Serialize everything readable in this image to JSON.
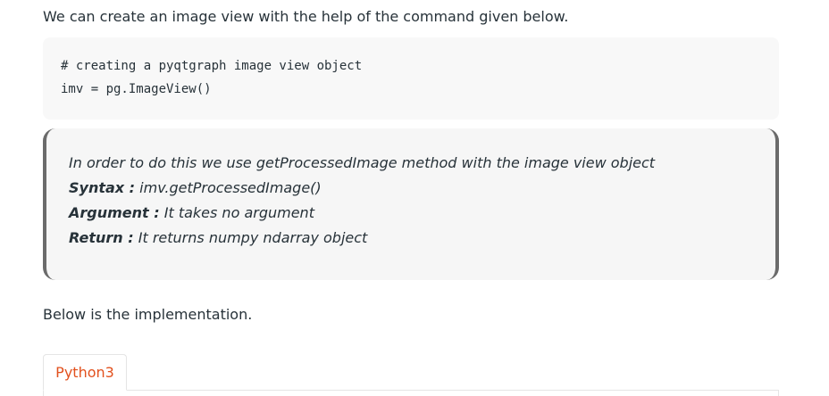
{
  "article": {
    "intro_text": "We can create an image view with the help of the command given below.",
    "code_lines": [
      "# creating a pyqtgraph image view object",
      "imv = pg.ImageView()"
    ],
    "quote": {
      "description": "In order to do this we use getProcessedImage method with the image view object",
      "syntax_label": "Syntax :",
      "syntax_value": " imv.getProcessedImage()",
      "argument_label": "Argument :",
      "argument_value": " It takes no argument",
      "return_label": "Return :",
      "return_value": " It returns numpy ndarray object"
    },
    "below_text": "Below is the implementation.",
    "tabs": [
      {
        "label": "Python3",
        "active": true
      }
    ]
  },
  "colors": {
    "text": "#273239",
    "code_bg": "#f8f8f8",
    "quote_bg": "#f6f6f6",
    "quote_border": "#6b6b6b",
    "tab_accent": "#e2511e"
  }
}
